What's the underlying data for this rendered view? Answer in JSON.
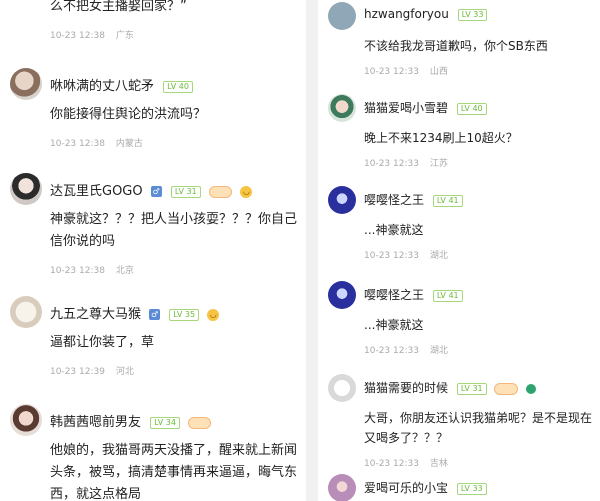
{
  "left": [
    {
      "name": "",
      "text": "么不把女主播娶回家？”",
      "time": "10-23 12:38",
      "loc": "广东"
    },
    {
      "name": "咻咻满的丈八蛇矛",
      "level": "LV 40",
      "text": "你能接得住舆论的洪流吗？",
      "time": "10-23 12:38",
      "loc": "内蒙古"
    },
    {
      "name": "达瓦里氏GOGO",
      "level": "LV 31",
      "text": "神豪就这？？？把人当小孩耍？？？你自己信你说的吗",
      "time": "10-23 12:38",
      "loc": "北京"
    },
    {
      "name": "九五之尊大马猴",
      "level": "LV 35",
      "text": "逼都让你装了，草",
      "time": "10-23 12:39",
      "loc": "河北"
    },
    {
      "name": "韩茜茜嗯前男友",
      "level": "LV 34",
      "text": "他娘的，我猫哥两天没播了，醒来就上新闻头条，被骂，搞清楚事情再来逼逼，晦气东西，就这点格局",
      "time": "",
      "loc": ""
    }
  ],
  "right": [
    {
      "name": "hzwangforyou",
      "level": "LV 33",
      "text": "不该给我龙哥道歉吗，你个SB东西",
      "time": "10-23 12:33",
      "loc": "山西"
    },
    {
      "name": "猫猫爱喝小雪碧",
      "level": "LV 40",
      "text": "晚上不来1234刷上10超火？",
      "time": "10-23 12:33",
      "loc": "江苏"
    },
    {
      "name": "嘤嘤怪之王",
      "level": "LV 41",
      "text": "...神豪就这",
      "time": "10-23 12:33",
      "loc": "湖北"
    },
    {
      "name": "嘤嘤怪之王",
      "level": "LV 41",
      "text": "...神豪就这",
      "time": "10-23 12:33",
      "loc": "湖北"
    },
    {
      "name": "猫猫需要的时候",
      "level": "LV 31",
      "text": "大哥，你朋友还认识我猫弟呢？是不是现在又喝多了？？？",
      "time": "10-23 12:33",
      "loc": "吉林"
    },
    {
      "name": "爱喝可乐的小宝",
      "level": "LV 33",
      "text": "",
      "time": "",
      "loc": ""
    }
  ],
  "colors": {
    "level": "#6cbb3b",
    "meta": "#aaaaaa",
    "text": "#222222"
  },
  "icons": {
    "verified": "gender-icon",
    "fan": "fan-badge-icon",
    "emoji": "smile-icon"
  }
}
